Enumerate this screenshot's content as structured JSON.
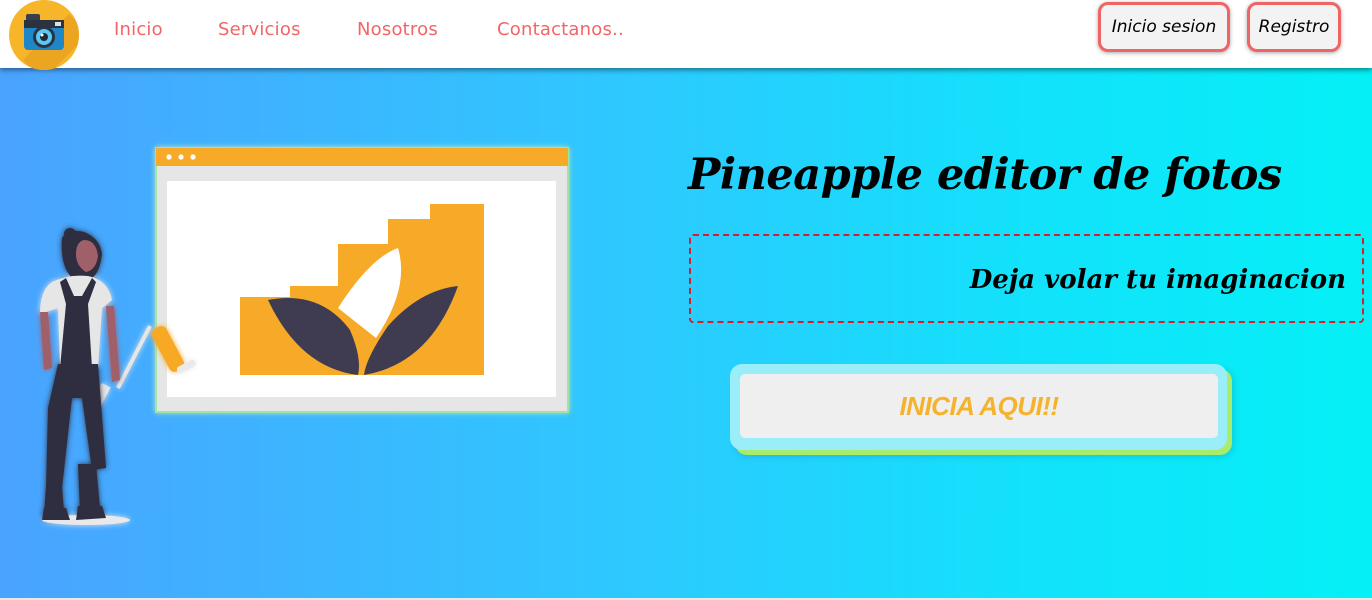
{
  "nav": {
    "links": [
      "Inicio",
      "Servicios",
      "Nosotros",
      "Contactanos.."
    ],
    "login_label": "Inicio sesion",
    "register_label": "Registro"
  },
  "hero": {
    "title": "Pineapple editor de fotos",
    "tagline": "Deja volar tu imaginacion",
    "cta_label": "INICIA AQUI!!"
  },
  "icons": {
    "logo": "camera-icon",
    "illustration": "woman-painting-canvas-illustration"
  },
  "colors": {
    "nav_link": "#f26565",
    "button_border": "#ef6464",
    "logo_bg": "#f7b62a",
    "cta_text": "#f7b22c",
    "hero_gradient_start": "#4aa3ff",
    "hero_gradient_end": "#04f0f6",
    "dashed_border": "#d61f26"
  }
}
